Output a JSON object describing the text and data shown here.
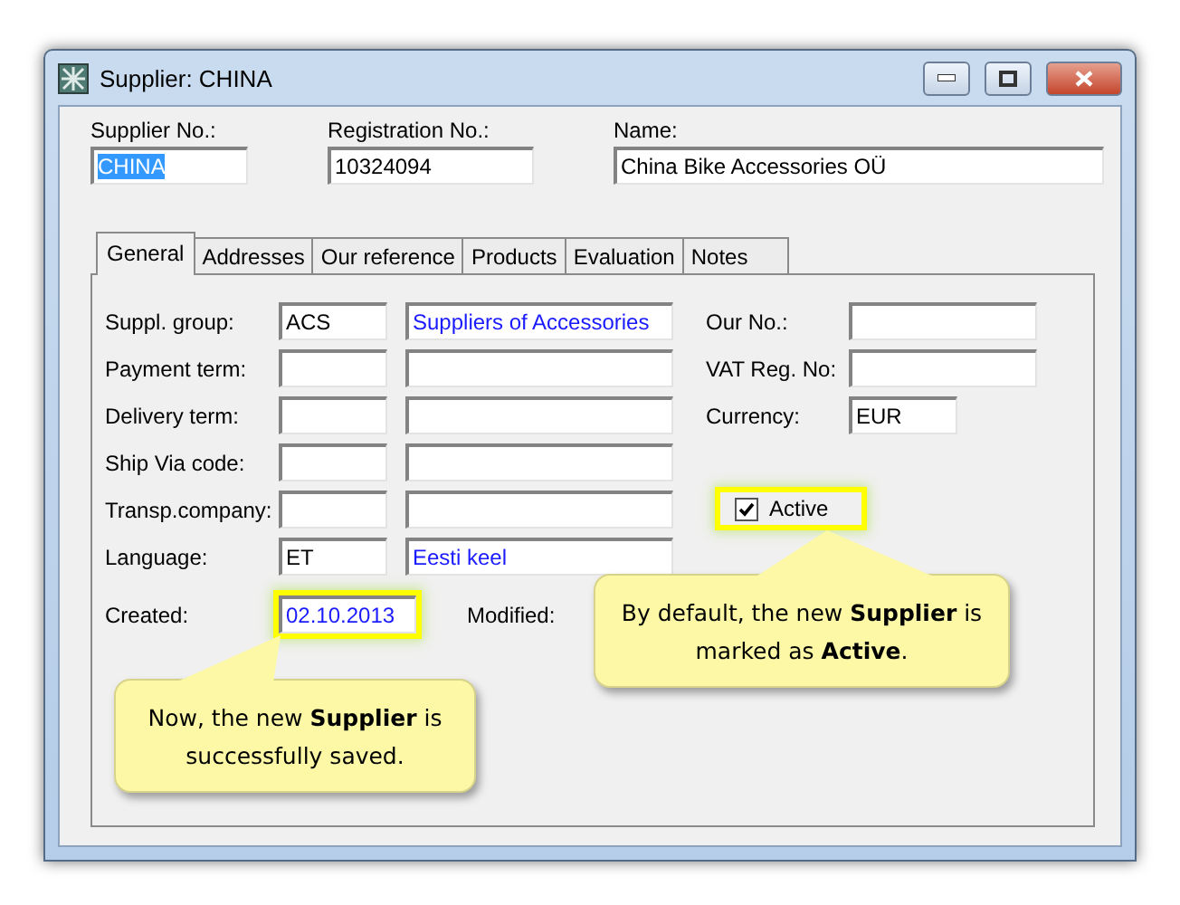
{
  "window": {
    "title": "Supplier: CHINA"
  },
  "header_fields": [
    {
      "label": "Supplier No.:",
      "value": "CHINA",
      "text_selected": true
    },
    {
      "label": "Registration No.:",
      "value": "10324094",
      "text_selected": false
    },
    {
      "label": "Name:",
      "value": "China Bike Accessories OÜ",
      "text_selected": false
    }
  ],
  "tabs": [
    {
      "label": "General",
      "selected": true
    },
    {
      "label": "Addresses",
      "selected": false
    },
    {
      "label": "Our reference",
      "selected": false
    },
    {
      "label": "Products",
      "selected": false
    },
    {
      "label": "Evaluation",
      "selected": false
    },
    {
      "label": "Notes",
      "selected": false
    }
  ],
  "left_rows": [
    {
      "label": "Suppl. group:",
      "code": "ACS",
      "description": "Suppliers of Accessories"
    },
    {
      "label": "Payment term:"
    },
    {
      "label": "Delivery term:"
    },
    {
      "label": "Ship Via code:"
    },
    {
      "label": "Transp.company:"
    },
    {
      "label": "Language:",
      "code": "ET",
      "description": "Eesti keel"
    }
  ],
  "right_rows": [
    {
      "label": "Our No.:",
      "kind": "wide"
    },
    {
      "label": "VAT Reg. No:",
      "kind": "wide"
    },
    {
      "label": "Currency:",
      "value": "EUR",
      "kind": "short"
    }
  ],
  "active_checkbox": {
    "label": "Active",
    "checked": true,
    "highlighted": true
  },
  "created": {
    "label": "Created:",
    "value": "02.10.2013",
    "highlighted": true
  },
  "modified": {
    "label": "Modified:"
  },
  "callouts": [
    {
      "text": "By default, the new **Supplier** is marked as **Active**."
    },
    {
      "text": "Now, the new **Supplier** is successfully saved."
    }
  ]
}
